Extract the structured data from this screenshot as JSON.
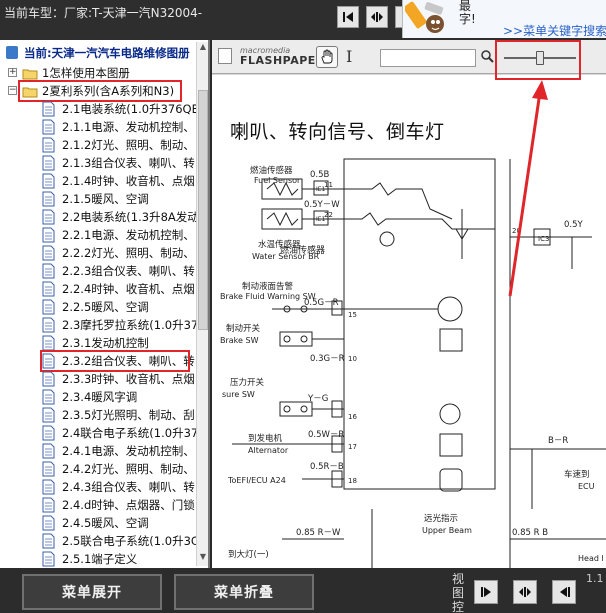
{
  "window": {
    "title": "当前车型：厂家:T-天津一汽N32004-"
  },
  "ad": {
    "line1": "最",
    "line2": "字!",
    "link": ">>菜单关键字搜索"
  },
  "tree": {
    "root": "当前:天津一汽汽车电路维修图册",
    "items": [
      {
        "label": "1怎样使用本图册",
        "kind": "folder",
        "expander": "+"
      },
      {
        "label": "2夏利系列(含A系列和N3)",
        "kind": "folder-open",
        "expander": "−"
      },
      {
        "label": "2.1电装系统(1.0升376QE",
        "kind": "page"
      },
      {
        "label": "2.1.1电源、发动机控制、",
        "kind": "page"
      },
      {
        "label": "2.1.2灯光、照明、制动、",
        "kind": "page"
      },
      {
        "label": "2.1.3组合仪表、喇叭、转",
        "kind": "page"
      },
      {
        "label": "2.1.4时钟、收音机、点烟",
        "kind": "page"
      },
      {
        "label": "2.1.5暖风、空调",
        "kind": "page"
      },
      {
        "label": "2.2电装系统(1.3升8A发动",
        "kind": "page"
      },
      {
        "label": "2.2.1电源、发动机控制、",
        "kind": "page"
      },
      {
        "label": "2.2.2灯光、照明、制动、",
        "kind": "page"
      },
      {
        "label": "2.2.3组合仪表、喇叭、转",
        "kind": "page"
      },
      {
        "label": "2.2.4时钟、收音机、点烟",
        "kind": "page"
      },
      {
        "label": "2.2.5暖风、空调",
        "kind": "page"
      },
      {
        "label": "2.3摩托罗拉系统(1.0升37",
        "kind": "page"
      },
      {
        "label": "2.3.1发动机控制",
        "kind": "page"
      },
      {
        "label": "2.3.2组合仪表、喇叭、转",
        "kind": "page",
        "selected": true
      },
      {
        "label": "2.3.3时钟、收音机、点烟",
        "kind": "page"
      },
      {
        "label": "2.3.4暖风字调",
        "kind": "page"
      },
      {
        "label": "2.3.5灯光照明、制动、刮",
        "kind": "page"
      },
      {
        "label": "2.4联合电子系统(1.0升37",
        "kind": "page"
      },
      {
        "label": "2.4.1电源、发动机控制、",
        "kind": "page"
      },
      {
        "label": "2.4.2灯光、照明、制动、",
        "kind": "page"
      },
      {
        "label": "2.4.3组合仪表、喇叭、转",
        "kind": "page"
      },
      {
        "label": "2.4.d时钟、点烟器、门锁",
        "kind": "page"
      },
      {
        "label": "2.4.5暖风、空调",
        "kind": "page"
      },
      {
        "label": "2.5联合电子系统(1.0升3C",
        "kind": "page"
      },
      {
        "label": "2.5.1端子定义",
        "kind": "page"
      }
    ]
  },
  "viewer": {
    "brand_small": "macromedia",
    "brand": "FLASHPAPER",
    "zoom_value": "1",
    "slider_fraction": 0.5
  },
  "document": {
    "heading": "喇叭、转向信号、倒车灯",
    "labels": {
      "fuel_sensor_cn": "燃油传感器",
      "fuel_sensor_en": "Fuel Sensor",
      "water_sensor_cn": "水温传感器",
      "water_sensor_en": "Water Sensor BR",
      "brake_cn": "制动液面告警",
      "brake_en": "Brake Fluid Warning SW",
      "brake_sw_cn": "制动开关",
      "brake_sw_en": "Brake SW",
      "pressure_cn": "压力开关",
      "pressure_en": "sure SW",
      "alt_cn": "到发电机",
      "alt_en": "Alternator",
      "toefi": "ToEFI/ECU A24",
      "upper_cn": "远光指示",
      "upper_en": "Upper Beam",
      "to_headlamp": "到大灯(一)",
      "speed_cn": "车速到",
      "ecu": "ECU",
      "head_l": "Head l",
      "w05b": "0.5B",
      "w05yw": "0.5Y－W",
      "w05gr": "0.5G－R",
      "w03gr": "0.3G－R",
      "w05yg": "Y－G",
      "w05wr": "0.5W－R",
      "w05rb": "0.5R－B",
      "w085rw": "0.85 R－W",
      "w085rb": "0.85 R B",
      "w05y": "0.5Y",
      "br": "B－R",
      "ic3": "IC3",
      "pins": [
        "11",
        "22",
        "15",
        "10",
        "16",
        "17",
        "18",
        "20"
      ],
      "ie_label": "IE1"
    }
  },
  "bottom": {
    "expand_label": "菜单展开",
    "collapse_label": "菜单折叠",
    "view_label": "视图控",
    "page_label": "1.1"
  }
}
